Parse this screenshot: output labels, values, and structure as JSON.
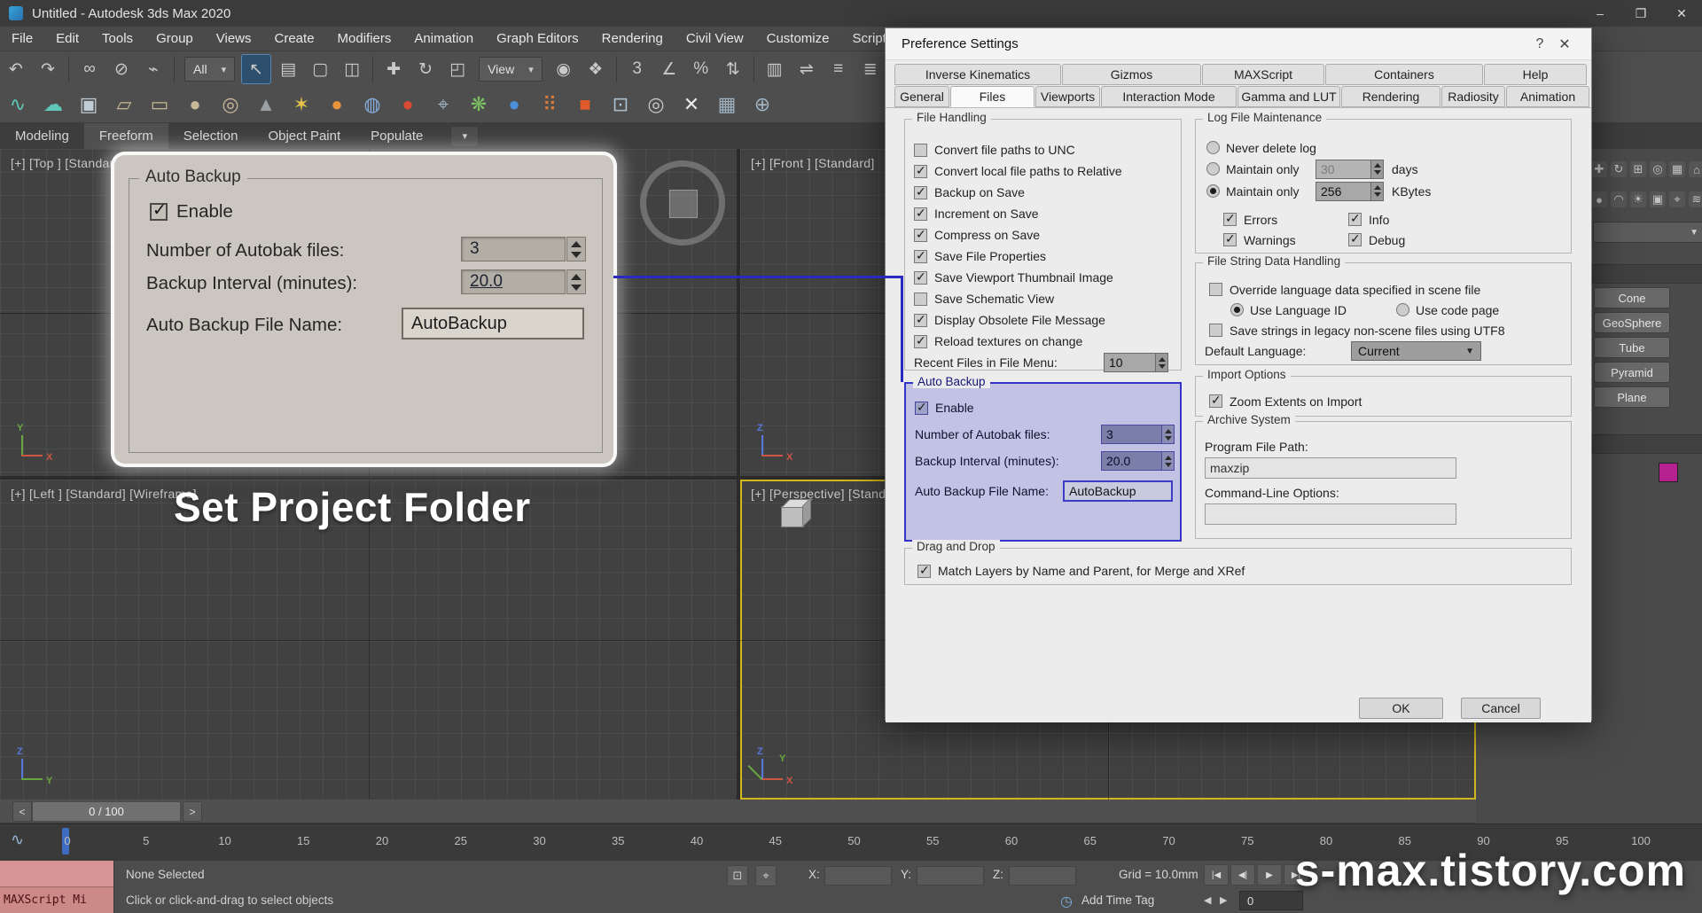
{
  "titlebar": {
    "title": "Untitled - Autodesk 3ds Max 2020",
    "min_glyph": "–",
    "max_glyph": "❐",
    "close_glyph": "✕"
  },
  "menubar": {
    "items": [
      "File",
      "Edit",
      "Tools",
      "Group",
      "Views",
      "Create",
      "Modifiers",
      "Animation",
      "Graph Editors",
      "Rendering",
      "Civil View",
      "Customize",
      "Scripting"
    ]
  },
  "toolbar1": {
    "items": [
      {
        "t": "i",
        "name": "undo-icon",
        "g": "↶"
      },
      {
        "t": "i",
        "name": "redo-icon",
        "g": "↷"
      },
      {
        "t": "s"
      },
      {
        "t": "i",
        "name": "select-and-link-icon",
        "g": "∞"
      },
      {
        "t": "i",
        "name": "unlink-selection-icon",
        "g": "⊘"
      },
      {
        "t": "i",
        "name": "bind-to-space-warp-icon",
        "g": "⌁"
      },
      {
        "t": "s"
      },
      {
        "t": "d",
        "name": "selection-filter-dropdown",
        "label": "All"
      },
      {
        "t": "i",
        "name": "select-object-icon",
        "g": "↖",
        "sel": true
      },
      {
        "t": "i",
        "name": "select-by-name-icon",
        "g": "▤"
      },
      {
        "t": "i",
        "name": "rectangular-selection-icon",
        "g": "▢"
      },
      {
        "t": "i",
        "name": "window-crossing-icon",
        "g": "◫"
      },
      {
        "t": "s"
      },
      {
        "t": "i",
        "name": "select-and-move-icon",
        "g": "✚"
      },
      {
        "t": "i",
        "name": "select-and-rotate-icon",
        "g": "↻"
      },
      {
        "t": "i",
        "name": "select-and-scale-icon",
        "g": "◰"
      },
      {
        "t": "d",
        "name": "reference-coordinate-dropdown",
        "label": "View"
      },
      {
        "t": "i",
        "name": "use-pivot-point-icon",
        "g": "◉"
      },
      {
        "t": "i",
        "name": "select-and-manipulate-icon",
        "g": "❖"
      },
      {
        "t": "s"
      },
      {
        "t": "i",
        "name": "snap-toggle-icon",
        "g": "3"
      },
      {
        "t": "i",
        "name": "angle-snap-icon",
        "g": "∠"
      },
      {
        "t": "i",
        "name": "percent-snap-icon",
        "g": "%"
      },
      {
        "t": "i",
        "name": "spinner-snap-icon",
        "g": "⇅"
      },
      {
        "t": "s"
      },
      {
        "t": "i",
        "name": "edit-named-selection-sets-icon",
        "g": "▥"
      },
      {
        "t": "i",
        "name": "mirror-icon",
        "g": "⇌"
      },
      {
        "t": "i",
        "name": "align-icon",
        "g": "≡"
      },
      {
        "t": "i",
        "name": "scene-explorer-icon",
        "g": "≣"
      },
      {
        "t": "i",
        "name": "curve-editor-icon",
        "g": "∿"
      },
      {
        "t": "i",
        "name": "schematic-view-icon",
        "g": "⊞"
      },
      {
        "t": "i",
        "name": "material-editor-icon",
        "g": "◐"
      },
      {
        "t": "i",
        "name": "render-setup-icon",
        "g": "◍"
      }
    ]
  },
  "toolbar2": {
    "items": [
      {
        "name": "relax-brush-icon",
        "g": "∿",
        "c": "#5fc8b8"
      },
      {
        "name": "polydraw-cloud-icon",
        "g": "☁",
        "c": "#5fc8b8"
      },
      {
        "name": "snapshot-icon",
        "g": "▣",
        "c": "#c2ccd4"
      },
      {
        "name": "plane-primitive-icon",
        "g": "▱",
        "c": "#c8b89a"
      },
      {
        "name": "box-primitive-icon",
        "g": "▭",
        "c": "#c8b89a"
      },
      {
        "name": "sphere-primitive-icon",
        "g": "●",
        "c": "#c8b89a"
      },
      {
        "name": "torus-primitive-icon",
        "g": "◎",
        "c": "#c8b89a"
      },
      {
        "name": "cone-primitive-icon",
        "g": "▲",
        "c": "#9aa0a4"
      },
      {
        "name": "star-shape-icon",
        "g": "✶",
        "c": "#e6c44a"
      },
      {
        "name": "omni-light-icon",
        "g": "●",
        "c": "#e8923c"
      },
      {
        "name": "sphere-cluster-icon",
        "g": "◍",
        "c": "#86aede"
      },
      {
        "name": "fire-effect-icon",
        "g": "●",
        "c": "#d84b36"
      },
      {
        "name": "pick-tool-icon",
        "g": "⌖",
        "c": "#9fb2c2"
      },
      {
        "name": "foliage-icon",
        "g": "❋",
        "c": "#7cc062"
      },
      {
        "name": "glossy-sphere-icon",
        "g": "●",
        "c": "#4a90d8"
      },
      {
        "name": "color-dots-icon",
        "g": "⠿",
        "c": "#d87a3a"
      },
      {
        "name": "exposure-icon",
        "g": "■",
        "c": "#e05a2c"
      },
      {
        "name": "monitor-icon",
        "g": "⊡",
        "c": "#a8c0d0"
      },
      {
        "name": "target-icon",
        "g": "◎",
        "c": "#c8c8c8"
      },
      {
        "name": "close-x-icon",
        "g": "✕",
        "c": "#e8e8e8"
      },
      {
        "name": "grid-tool-icon",
        "g": "▦",
        "c": "#9fb2c2"
      },
      {
        "name": "info-tool-icon",
        "g": "⊕",
        "c": "#9fb2c2"
      }
    ]
  },
  "ribbon": {
    "tabs": [
      {
        "label": "Modeling"
      },
      {
        "label": "Freeform",
        "active": true
      },
      {
        "label": "Selection"
      },
      {
        "label": "Object Paint"
      },
      {
        "label": "Populate"
      }
    ],
    "more_glyph": "▾"
  },
  "viewports": {
    "top_label": "[+] [Top ] [Standard]",
    "front_label": "[+] [Front ] [Standard]",
    "left_label": "[+] [Left ] [Standard] [Wireframe]",
    "persp_label": "[+] [Perspective] [Standard]",
    "axes": {
      "top": [
        "Y",
        "X"
      ],
      "front": [
        "Z",
        "X"
      ],
      "left": [
        "Z",
        "Y"
      ],
      "persp": [
        "Z",
        "X",
        "Y"
      ]
    }
  },
  "caption": "Set Project Folder",
  "watermark": "s-max.tistory.com",
  "colors": {
    "highlight_blue": "#3434c8",
    "connector_blue": "#2a2ac0",
    "viewport_active_border": "#d2b81e",
    "swatch_magenta": "#b5218e",
    "trackbar_marker_blue": "#3e6cc0",
    "axis_x": "#cc5544",
    "axis_y": "#66a83e",
    "axis_z": "#5577dd"
  },
  "dialog": {
    "title": "Preference Settings",
    "help_glyph": "?",
    "close_glyph": "✕",
    "tabs_row1": [
      "Inverse Kinematics",
      "Gizmos",
      "MAXScript",
      "Containers",
      "Help"
    ],
    "tabs_row2": [
      "General",
      "Files",
      "Viewports",
      "Interaction Mode",
      "Gamma and LUT",
      "Rendering",
      "Radiosity",
      "Animation"
    ],
    "active_tab": "Files",
    "file_handling": {
      "title": "File Handling",
      "items": [
        {
          "label": "Convert file paths to UNC",
          "checked": false
        },
        {
          "label": "Convert local file paths to Relative",
          "checked": true
        },
        {
          "label": "Backup on Save",
          "checked": true
        },
        {
          "label": "Increment on Save",
          "checked": true
        },
        {
          "label": "Compress on Save",
          "checked": true
        },
        {
          "label": "Save File Properties",
          "checked": true
        },
        {
          "label": "Save Viewport Thumbnail Image",
          "checked": true
        },
        {
          "label": "Save Schematic View",
          "checked": false
        },
        {
          "label": "Display Obsolete File Message",
          "checked": true
        },
        {
          "label": "Reload textures on change",
          "checked": true
        }
      ],
      "recent_label": "Recent Files in File Menu:",
      "recent_value": "10"
    },
    "auto_backup": {
      "title": "Auto Backup",
      "enable_label": "Enable",
      "enable_checked": true,
      "files_label": "Number of Autobak files:",
      "files_value": "3",
      "interval_label": "Backup Interval (minutes):",
      "interval_value": "20.0",
      "name_label": "Auto Backup File Name:",
      "name_value": "AutoBackup"
    },
    "drag_and_drop": {
      "title": "Drag and Drop",
      "match_label": "Match Layers by Name and Parent, for Merge and XRef",
      "checked": true
    },
    "log_file": {
      "title": "Log File Maintenance",
      "never_label": "Never delete log",
      "never_selected": false,
      "maintain_days_label": "Maintain only",
      "days_value": "30",
      "days_unit": "days",
      "days_selected": false,
      "maintain_kb_label": "Maintain only",
      "kb_value": "256",
      "kb_unit": "KBytes",
      "kb_selected": true,
      "errors_label": "Errors",
      "errors_checked": true,
      "info_label": "Info",
      "info_checked": true,
      "warnings_label": "Warnings",
      "warnings_checked": true,
      "debug_label": "Debug",
      "debug_checked": true
    },
    "string_handling": {
      "title": "File String Data Handling",
      "override_label": "Override language data specified in scene file",
      "override_checked": false,
      "language_id_label": "Use Language ID",
      "language_id_selected": true,
      "code_page_label": "Use code page",
      "code_page_selected": false,
      "utf8_label": "Save strings in legacy non-scene files using UTF8",
      "utf8_checked": false,
      "default_label": "Default Language:",
      "default_value": "Current"
    },
    "import_options": {
      "title": "Import Options",
      "zoom_label": "Zoom Extents on Import",
      "zoom_checked": true
    },
    "archive": {
      "title": "Archive System",
      "path_label": "Program File Path:",
      "path_value": "maxzip",
      "cmd_label": "Command-Line Options:",
      "cmd_value": ""
    },
    "ok_label": "OK",
    "cancel_label": "Cancel"
  },
  "command_panel": {
    "tab_icons": [
      {
        "name": "create-tab-icon",
        "g": "✚"
      },
      {
        "name": "modify-tab-icon",
        "g": "↻"
      },
      {
        "name": "hierarchy-tab-icon",
        "g": "⊞"
      },
      {
        "name": "motion-tab-icon",
        "g": "◎"
      },
      {
        "name": "display-tab-icon",
        "g": "▦"
      },
      {
        "name": "utilities-tab-icon",
        "g": "⌂"
      }
    ],
    "category_icons": [
      {
        "name": "geometry-category-icon",
        "g": "●"
      },
      {
        "name": "shapes-category-icon",
        "g": "◠"
      },
      {
        "name": "lights-category-icon",
        "g": "☀"
      },
      {
        "name": "cameras-category-icon",
        "g": "▣"
      },
      {
        "name": "helpers-category-icon",
        "g": "⌖"
      },
      {
        "name": "space-warps-category-icon",
        "g": "≋"
      }
    ],
    "dropdown_arrow": "▼",
    "buttons": [
      "Cone",
      "GeoSphere",
      "Tube",
      "Pyramid",
      "Plane"
    ]
  },
  "timeline": {
    "prev_glyph": "<",
    "next_glyph": ">",
    "slider_label": "0 / 100",
    "curve_icon": "∿",
    "ticks": [
      "0",
      "5",
      "10",
      "15",
      "20",
      "25",
      "30",
      "35",
      "40",
      "45",
      "50",
      "55",
      "60",
      "65",
      "70",
      "75",
      "80",
      "85",
      "90",
      "95",
      "100"
    ]
  },
  "statusbar": {
    "maxscript_label": "MAXScript Mi",
    "selected_text": "None Selected",
    "prompt_text": "Click or click-and-drag to select objects",
    "isolate_icon": "⊡",
    "lock_icon": "⌖",
    "x_label": "X:",
    "y_label": "Y:",
    "z_label": "Z:",
    "grid_text": "Grid = 10.0mm",
    "clock_icon": "◷",
    "add_time_tag": "Add Time Tag",
    "playback_icons": [
      "|◀",
      "◀|",
      "▶",
      "▶|"
    ],
    "frame_prev": "◀",
    "frame_next": "▶",
    "frame_value": "0"
  }
}
